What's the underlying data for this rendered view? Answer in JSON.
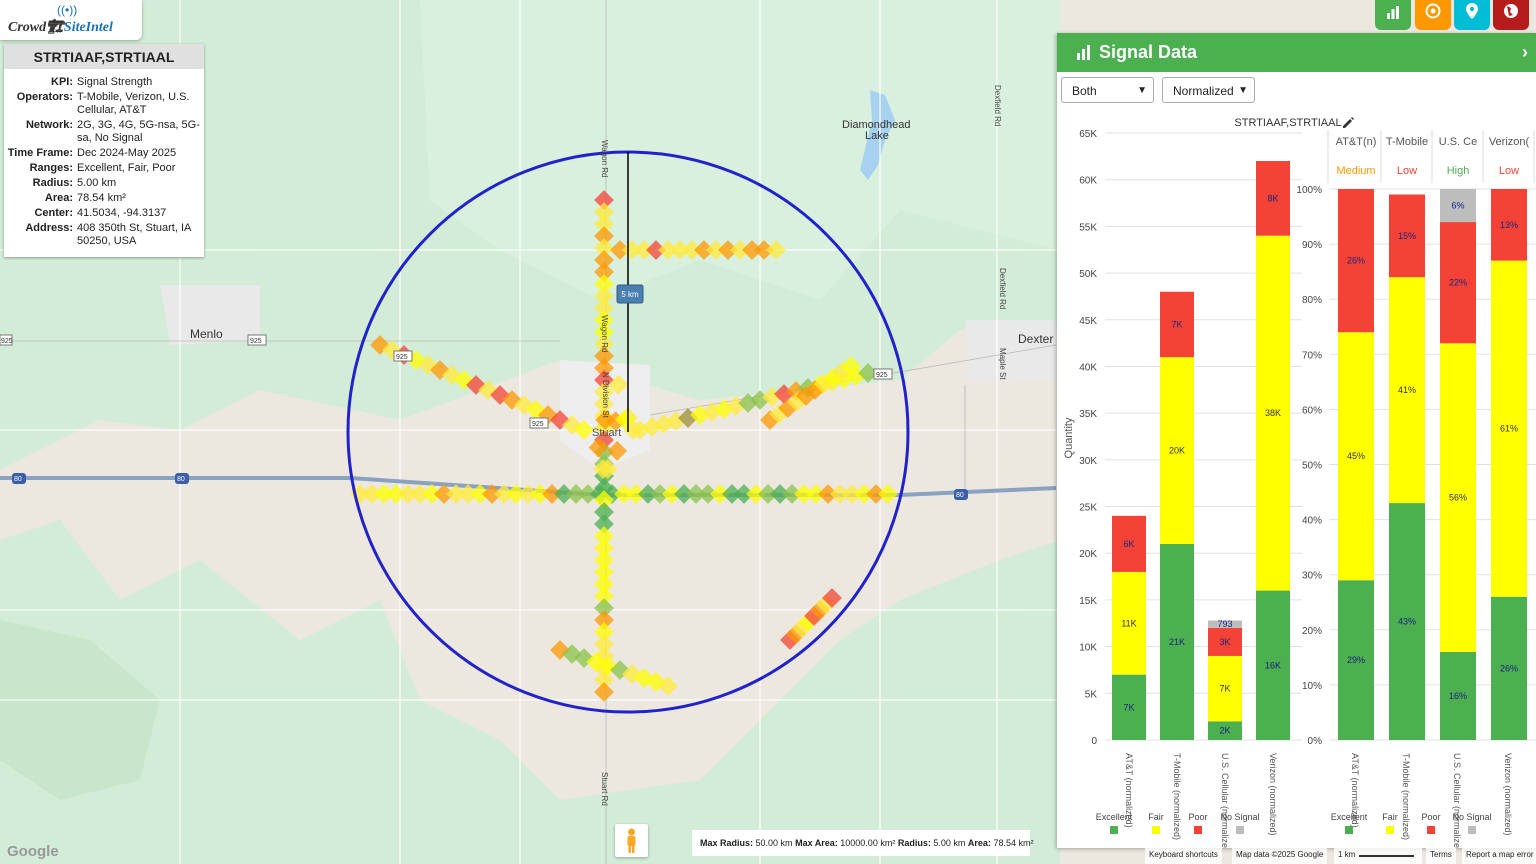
{
  "app": {
    "logo_crowd": "Crowd",
    "logo_site": "SiteIntel"
  },
  "info": {
    "title": "STRTIAAF,STRTIAAL",
    "rows": [
      {
        "k": "KPI:",
        "v": "Signal Strength"
      },
      {
        "k": "Operators:",
        "v": "T-Mobile, Verizon, U.S. Cellular, AT&T"
      },
      {
        "k": "Network:",
        "v": "2G, 3G, 4G, 5G-nsa, 5G-sa, No Signal"
      },
      {
        "k": "Time Frame:",
        "v": "Dec 2024-May 2025"
      },
      {
        "k": "Ranges:",
        "v": "Excellent, Fair, Poor"
      },
      {
        "k": "Radius:",
        "v": "5.00 km"
      },
      {
        "k": "Area:",
        "v": "78.54 km²"
      },
      {
        "k": "Center:",
        "v": "41.5034, -94.3137"
      },
      {
        "k": "Address:",
        "v": "408 350th St, Stuart, IA 50250, USA"
      }
    ]
  },
  "map": {
    "places": [
      "Menlo",
      "Dexter",
      "Diamondhead Lake",
      "Stuart"
    ],
    "roads": [
      "Wagon Rd",
      "Dexfield Rd",
      "Maple St",
      "Stuart Rd",
      "N Division St",
      "925",
      "80"
    ],
    "radius_label": "5 km",
    "footer": {
      "max_radius_k": "Max Radius:",
      "max_radius_v": "50.00 km",
      "max_area_k": "Max Area:",
      "max_area_v": "10000.00 km²",
      "radius_k": "Radius:",
      "radius_v": "5.00 km",
      "area_k": "Area:",
      "area_v": "78.54 km²"
    },
    "attribution": {
      "shortcuts": "Keyboard shortcuts",
      "data": "Map data ©2025 Google",
      "scale": "1 km",
      "terms": "Terms",
      "report": "Report a map error",
      "google": "Google"
    }
  },
  "toolbar": {
    "buttons": [
      {
        "icon": "bar-chart-icon",
        "color": "#4caf50"
      },
      {
        "icon": "target-icon",
        "color": "#ff9800"
      },
      {
        "icon": "location-pin-icon",
        "color": "#00bcd4"
      },
      {
        "icon": "globe-icon",
        "color": "#b71c1c"
      }
    ]
  },
  "panel": {
    "title": "Signal Data",
    "select_mode": "Both",
    "select_scale": "Normalized",
    "chart_title": "STRTIAAF,STRTIAAL"
  },
  "colors": {
    "excellent": "#4caf50",
    "fair": "#ffff00",
    "poor": "#f44336",
    "nosignal": "#bdbdbd"
  },
  "chart_data": [
    {
      "type": "bar",
      "stacked": true,
      "categories": [
        "AT&T (normalized)",
        "T-Mobile (normalized)",
        "U.S. Cellular (normalized)",
        "Verizon (normalized)"
      ],
      "ylabel": "Quantity",
      "ylim": [
        0,
        65000
      ],
      "yticks": [
        "0",
        "5K",
        "10K",
        "15K",
        "20K",
        "25K",
        "30K",
        "35K",
        "40K",
        "45K",
        "50K",
        "55K",
        "60K",
        "65K"
      ],
      "series": [
        {
          "name": "Excellent",
          "values": [
            7000,
            21000,
            2000,
            16000
          ],
          "labels": [
            "7K",
            "21K",
            "2K",
            "16K"
          ]
        },
        {
          "name": "Fair",
          "values": [
            11000,
            20000,
            7000,
            38000
          ],
          "labels": [
            "11K",
            "20K",
            "7K",
            "38K"
          ]
        },
        {
          "name": "Poor",
          "values": [
            6000,
            7000,
            3000,
            8000
          ],
          "labels": [
            "6K",
            "7K",
            "3K",
            "8K"
          ]
        },
        {
          "name": "No Signal",
          "values": [
            0,
            0,
            793,
            0
          ],
          "labels": [
            "",
            "",
            "793",
            ""
          ]
        }
      ],
      "legend": [
        "Excellent",
        "Fair",
        "Poor",
        "No Signal"
      ]
    },
    {
      "type": "bar",
      "stacked": true,
      "categories": [
        "AT&T (normalized)",
        "T-Mobile (normalized)",
        "U.S. Cellular (normalized)",
        "Verizon (normalized)"
      ],
      "ylim": [
        0,
        100
      ],
      "yticks": [
        "0%",
        "10%",
        "20%",
        "30%",
        "40%",
        "50%",
        "60%",
        "70%",
        "80%",
        "90%",
        "100%"
      ],
      "headers": [
        "AT&T(n)",
        "T-Mobile",
        "U.S. Ce",
        "Verizon("
      ],
      "ratings": [
        {
          "text": "Medium",
          "color": "#ff9800"
        },
        {
          "text": "Low",
          "color": "#f44336"
        },
        {
          "text": "High",
          "color": "#4caf50"
        },
        {
          "text": "Low",
          "color": "#f44336"
        }
      ],
      "series": [
        {
          "name": "Excellent",
          "values": [
            29,
            43,
            16,
            26
          ]
        },
        {
          "name": "Fair",
          "values": [
            45,
            41,
            56,
            61
          ]
        },
        {
          "name": "Poor",
          "values": [
            26,
            15,
            22,
            13
          ]
        },
        {
          "name": "No Signal",
          "values": [
            0,
            0,
            6,
            0
          ]
        }
      ],
      "legend": [
        "Excellent",
        "Fair",
        "Poor",
        "No Signal"
      ]
    }
  ]
}
